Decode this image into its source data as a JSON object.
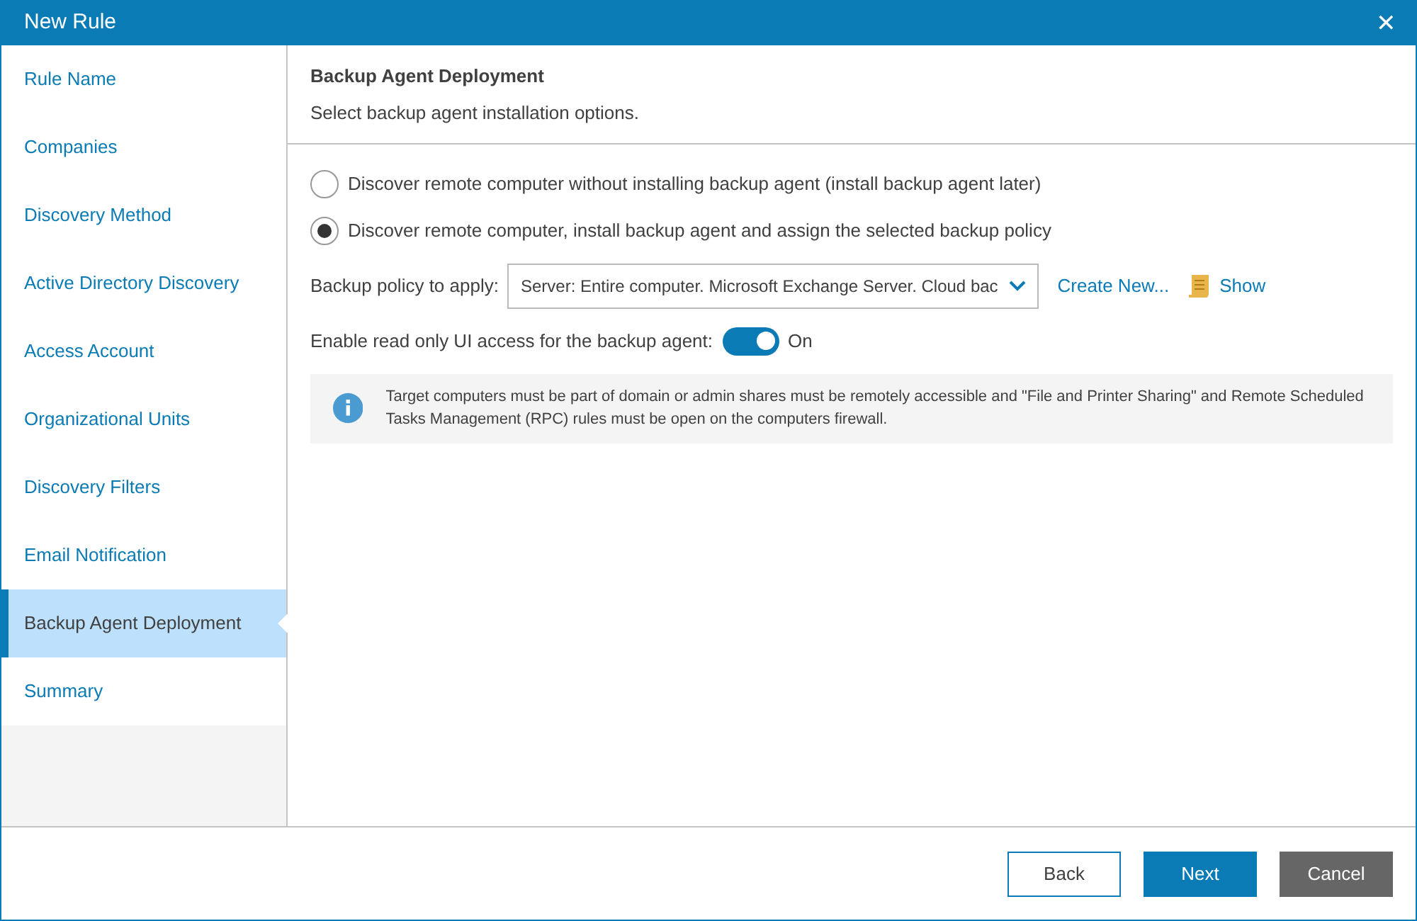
{
  "window": {
    "title": "New Rule",
    "close": "✕"
  },
  "sidebar": {
    "items": [
      {
        "label": "Rule Name",
        "selected": false
      },
      {
        "label": "Companies",
        "selected": false
      },
      {
        "label": "Discovery Method",
        "selected": false
      },
      {
        "label": "Active Directory Discovery",
        "selected": false
      },
      {
        "label": "Access Account",
        "selected": false
      },
      {
        "label": "Organizational Units",
        "selected": false
      },
      {
        "label": "Discovery Filters",
        "selected": false
      },
      {
        "label": "Email Notification",
        "selected": false
      },
      {
        "label": "Backup Agent Deployment",
        "selected": true
      },
      {
        "label": "Summary",
        "selected": false
      }
    ]
  },
  "header": {
    "title": "Backup Agent Deployment",
    "subtitle": "Select backup agent installation options."
  },
  "options": [
    {
      "label": "Discover remote computer without installing backup agent (install backup agent later)",
      "selected": false
    },
    {
      "label": "Discover remote computer, install backup agent and assign the selected backup policy",
      "selected": true
    }
  ],
  "policy": {
    "label": "Backup policy to apply:",
    "value": "Server: Entire computer. Microsoft Exchange Server. Cloud bac",
    "create_link": "Create New...",
    "show_link": "Show"
  },
  "readonly_access": {
    "label": "Enable read only UI access for the backup agent:",
    "on": true,
    "state_text": "On"
  },
  "info": "Target computers must be part of domain or admin shares must be remotely accessible and \"File and Printer Sharing\" and Remote Scheduled Tasks Management (RPC) rules must be open on the computers firewall.",
  "buttons": [
    {
      "label": "Back",
      "kind": "outline"
    },
    {
      "label": "Next",
      "kind": "primary"
    },
    {
      "label": "Cancel",
      "kind": "secondary"
    }
  ]
}
